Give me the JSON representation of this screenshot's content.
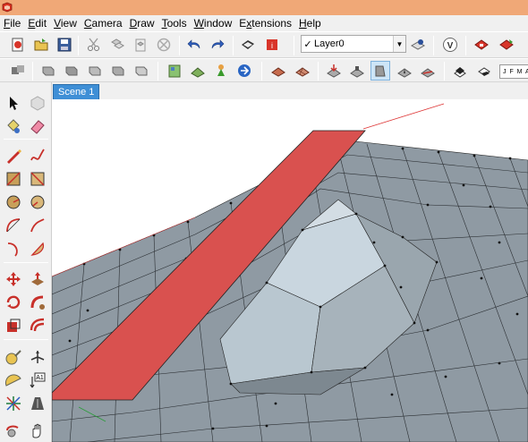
{
  "menu": {
    "items": [
      {
        "pre": "",
        "u": "F",
        "post": "ile"
      },
      {
        "pre": "",
        "u": "E",
        "post": "dit"
      },
      {
        "pre": "",
        "u": "V",
        "post": "iew"
      },
      {
        "pre": "",
        "u": "C",
        "post": "amera"
      },
      {
        "pre": "",
        "u": "D",
        "post": "raw"
      },
      {
        "pre": "",
        "u": "T",
        "post": "ools"
      },
      {
        "pre": "",
        "u": "W",
        "post": "indow"
      },
      {
        "pre": "E",
        "u": "x",
        "post": "tensions"
      },
      {
        "pre": "",
        "u": "H",
        "post": "elp"
      }
    ]
  },
  "toolbar": {
    "layer": "Layer0",
    "layer_check": "✓",
    "calendar_text": "J F M A M"
  },
  "scenes": {
    "active_tab": "Scene 1"
  },
  "colors": {
    "titlebar": "#f0a877",
    "chrome": "#f0f0f0",
    "scene_tab": "#3f8fd6",
    "selected_face": "#d9514f",
    "terrain_face": "#8f9aa3",
    "terrain_light": "#c9d6df"
  }
}
